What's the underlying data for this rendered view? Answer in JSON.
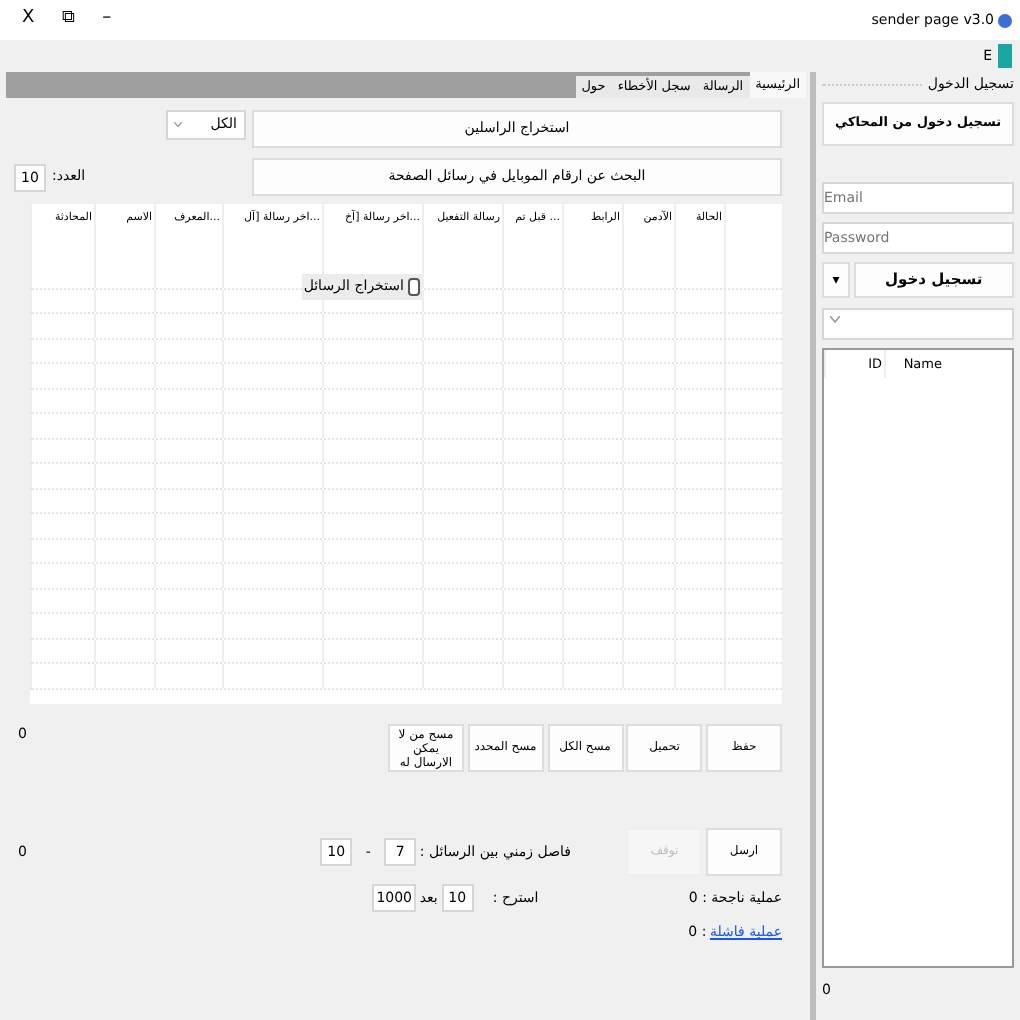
{
  "window": {
    "title": "sender page v3.0",
    "controls": [
      "–",
      "⧉",
      "X"
    ]
  },
  "toolbar": {
    "label": "E"
  },
  "tabs": [
    {
      "label": "الرئيسية",
      "selected": true
    },
    {
      "label": "الرسالة",
      "selected": false
    },
    {
      "label": "سجل الأخطاء",
      "selected": false
    },
    {
      "label": "حول",
      "selected": false
    }
  ],
  "extract": {
    "button": "استخراج الراسلين",
    "filter": "الكل"
  },
  "search": {
    "button": "البحث عن ارقام الموبايل في رسائل الصفحة",
    "count_label": "العدد:",
    "count": "10"
  },
  "grid": {
    "columns": [
      "الحالة",
      "الآدمن",
      "الرابط",
      "... قبل تم",
      "رسالة التفعيل",
      "...اخر رسالة [آخ",
      "...اخر رسالة [آل",
      "...المعرف",
      "الاسم",
      "المحادثة"
    ],
    "extract_checkbox": {
      "label": "استخراج الرسائل",
      "checked": false
    }
  },
  "actions": {
    "buttons": [
      "حفظ",
      "تحميل",
      "مسح الكل",
      "مسح المحدد",
      "مسح من لا يمكن الارسال له"
    ],
    "count": "0"
  },
  "send": {
    "send_button": {
      "label": "ارسل",
      "disabled": false
    },
    "stop_button": {
      "label": "توقف",
      "disabled": true
    },
    "interval_label": "فاصل زمني بين الرسائل :",
    "interval_from": "7",
    "range_separator": "-",
    "interval_to": "10",
    "rest_label": "استرح :",
    "rest_value": "10",
    "after_label": "بعد",
    "after_value": "1000",
    "success": "عملية ناجحة : 0",
    "failed_link": "عملية فاشلة",
    "failed_count": ": 0",
    "count": "0"
  },
  "login": {
    "title": "تسجيل الدخول",
    "emulator_button": "تسجيل دخول من المحاكي",
    "email_placeholder": "Email",
    "password_placeholder": "Password",
    "login_button": "تسجيل دخول",
    "dropdown_arrow": "▾",
    "accounts": {
      "columns": [
        "Name",
        "ID"
      ]
    },
    "count": "0"
  }
}
